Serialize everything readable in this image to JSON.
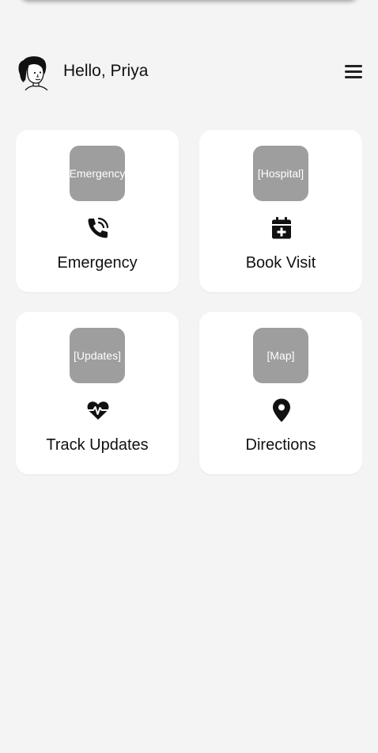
{
  "header": {
    "greeting": "Hello, Priya",
    "avatar": "avatar-illustration",
    "menu_icon": "hamburger-menu-icon"
  },
  "cards": [
    {
      "thumb_text": "Emergency",
      "icon": "phone-ringing-icon",
      "label": "Emergency"
    },
    {
      "thumb_text": "[Hospital]",
      "icon": "calendar-plus-icon",
      "label": "Book Visit"
    },
    {
      "thumb_text": "[Updates]",
      "icon": "heart-pulse-icon",
      "label": "Track Updates"
    },
    {
      "thumb_text": "[Map]",
      "icon": "map-pin-icon",
      "label": "Directions"
    }
  ],
  "colors": {
    "background": "#f4f4f4",
    "card": "#ffffff",
    "placeholder": "#9e9e9e",
    "text": "#111111"
  }
}
